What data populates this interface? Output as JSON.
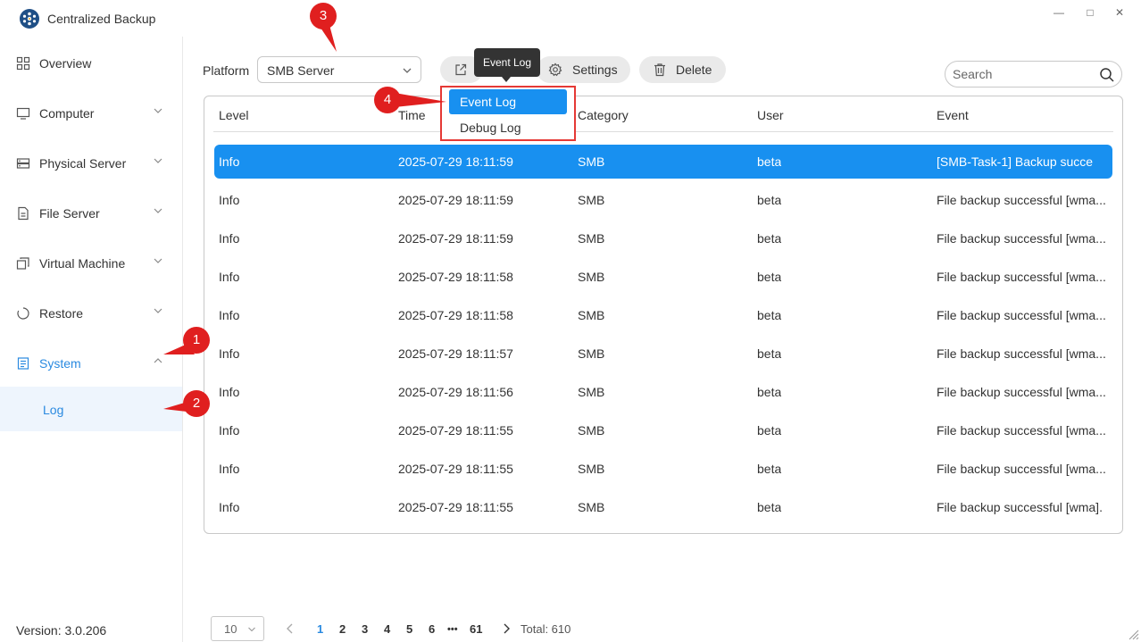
{
  "app": {
    "title": "Centralized Backup"
  },
  "window_controls": {
    "minimize": "—",
    "maximize": "□",
    "close": "✕"
  },
  "sidebar": {
    "items": [
      {
        "label": "Overview",
        "icon": "grid-icon"
      },
      {
        "label": "Computer",
        "icon": "monitor-icon"
      },
      {
        "label": "Physical Server",
        "icon": "server-icon"
      },
      {
        "label": "File Server",
        "icon": "file-server-icon"
      },
      {
        "label": "Virtual Machine",
        "icon": "virtual-machine-icon"
      },
      {
        "label": "Restore",
        "icon": "restore-icon"
      },
      {
        "label": "System",
        "icon": "system-icon"
      }
    ],
    "sub_items": [
      {
        "label": "Log"
      }
    ],
    "version": "Version: 3.0.206"
  },
  "toolbar": {
    "platform_label": "Platform",
    "platform_value": "SMB Server",
    "tooltip": "Event Log",
    "settings_label": "Settings",
    "delete_label": "Delete",
    "search_placeholder": "Search"
  },
  "export_menu": {
    "items": [
      {
        "label": "Event Log"
      },
      {
        "label": "Debug Log"
      }
    ]
  },
  "table": {
    "columns": [
      "Level",
      "Time",
      "Category",
      "User",
      "Event"
    ],
    "rows": [
      {
        "level": "Info",
        "time": "2025-07-29 18:11:59",
        "category": "SMB",
        "user": "beta",
        "event": "[SMB-Task-1] Backup succe"
      },
      {
        "level": "Info",
        "time": "2025-07-29 18:11:59",
        "category": "SMB",
        "user": "beta",
        "event": "File backup successful [wma..."
      },
      {
        "level": "Info",
        "time": "2025-07-29 18:11:59",
        "category": "SMB",
        "user": "beta",
        "event": "File backup successful [wma..."
      },
      {
        "level": "Info",
        "time": "2025-07-29 18:11:58",
        "category": "SMB",
        "user": "beta",
        "event": "File backup successful [wma..."
      },
      {
        "level": "Info",
        "time": "2025-07-29 18:11:58",
        "category": "SMB",
        "user": "beta",
        "event": "File backup successful [wma..."
      },
      {
        "level": "Info",
        "time": "2025-07-29 18:11:57",
        "category": "SMB",
        "user": "beta",
        "event": "File backup successful [wma..."
      },
      {
        "level": "Info",
        "time": "2025-07-29 18:11:56",
        "category": "SMB",
        "user": "beta",
        "event": "File backup successful [wma..."
      },
      {
        "level": "Info",
        "time": "2025-07-29 18:11:55",
        "category": "SMB",
        "user": "beta",
        "event": "File backup successful [wma..."
      },
      {
        "level": "Info",
        "time": "2025-07-29 18:11:55",
        "category": "SMB",
        "user": "beta",
        "event": "File backup successful [wma..."
      },
      {
        "level": "Info",
        "time": "2025-07-29 18:11:55",
        "category": "SMB",
        "user": "beta",
        "event": "File backup successful [wma]."
      }
    ]
  },
  "pagination": {
    "page_size": "10",
    "pages": [
      "1",
      "2",
      "3",
      "4",
      "5",
      "6",
      "•••",
      "61"
    ],
    "current_page": "1",
    "total": "Total: 610"
  },
  "callouts": [
    "1",
    "2",
    "3",
    "4"
  ],
  "colors": {
    "accent": "#1890f0",
    "callout": "#e01f1f",
    "highlight_box": "#e53935"
  }
}
